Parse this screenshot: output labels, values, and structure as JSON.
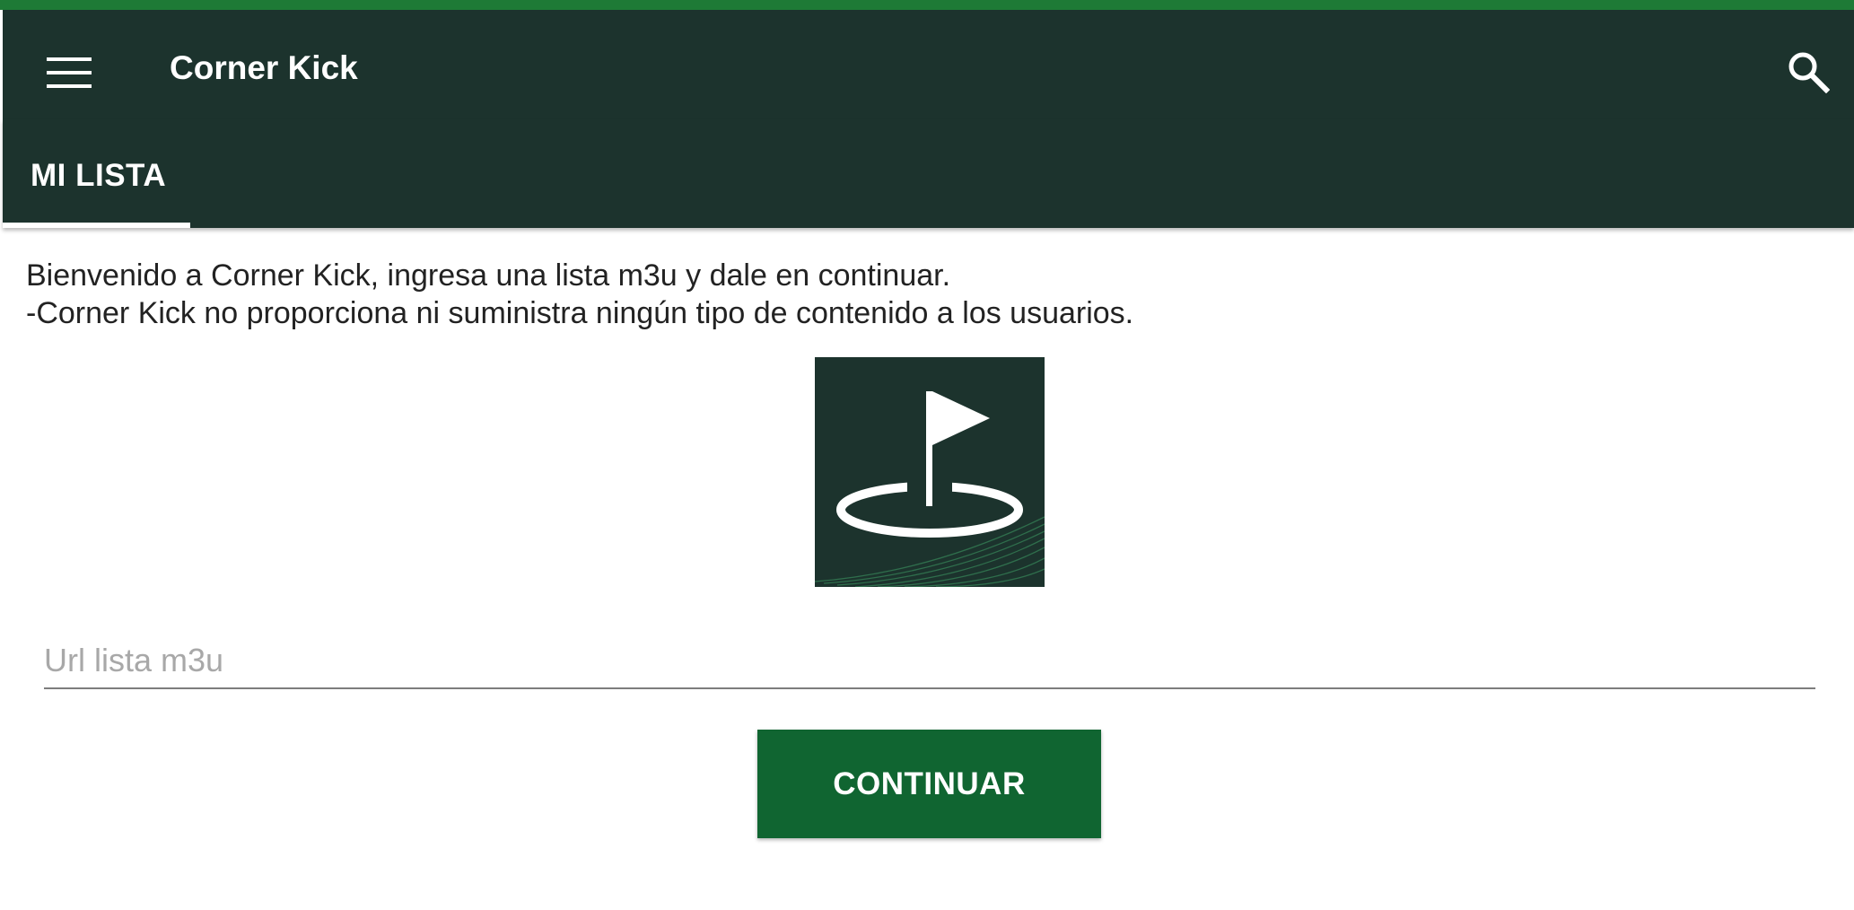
{
  "app": {
    "title": "Corner Kick",
    "accent_color": "#1e7a36",
    "toolbar_color": "#1c332d",
    "button_color": "#106531"
  },
  "toolbar": {
    "menu_icon": "hamburger-menu-icon",
    "search_icon": "search-icon"
  },
  "tabs": [
    {
      "label": "MI LISTA",
      "selected": true
    }
  ],
  "main": {
    "welcome_line1": "Bienvenido a Corner Kick, ingresa una lista m3u y dale en continuar.",
    "welcome_line2": "-Corner Kick no proporciona ni suministra ningún tipo de contenido a los usuarios.",
    "logo_icon": "golf-flag-logo-icon",
    "url_input": {
      "value": "",
      "placeholder": "Url lista m3u"
    },
    "continue_label": "CONTINUAR"
  }
}
